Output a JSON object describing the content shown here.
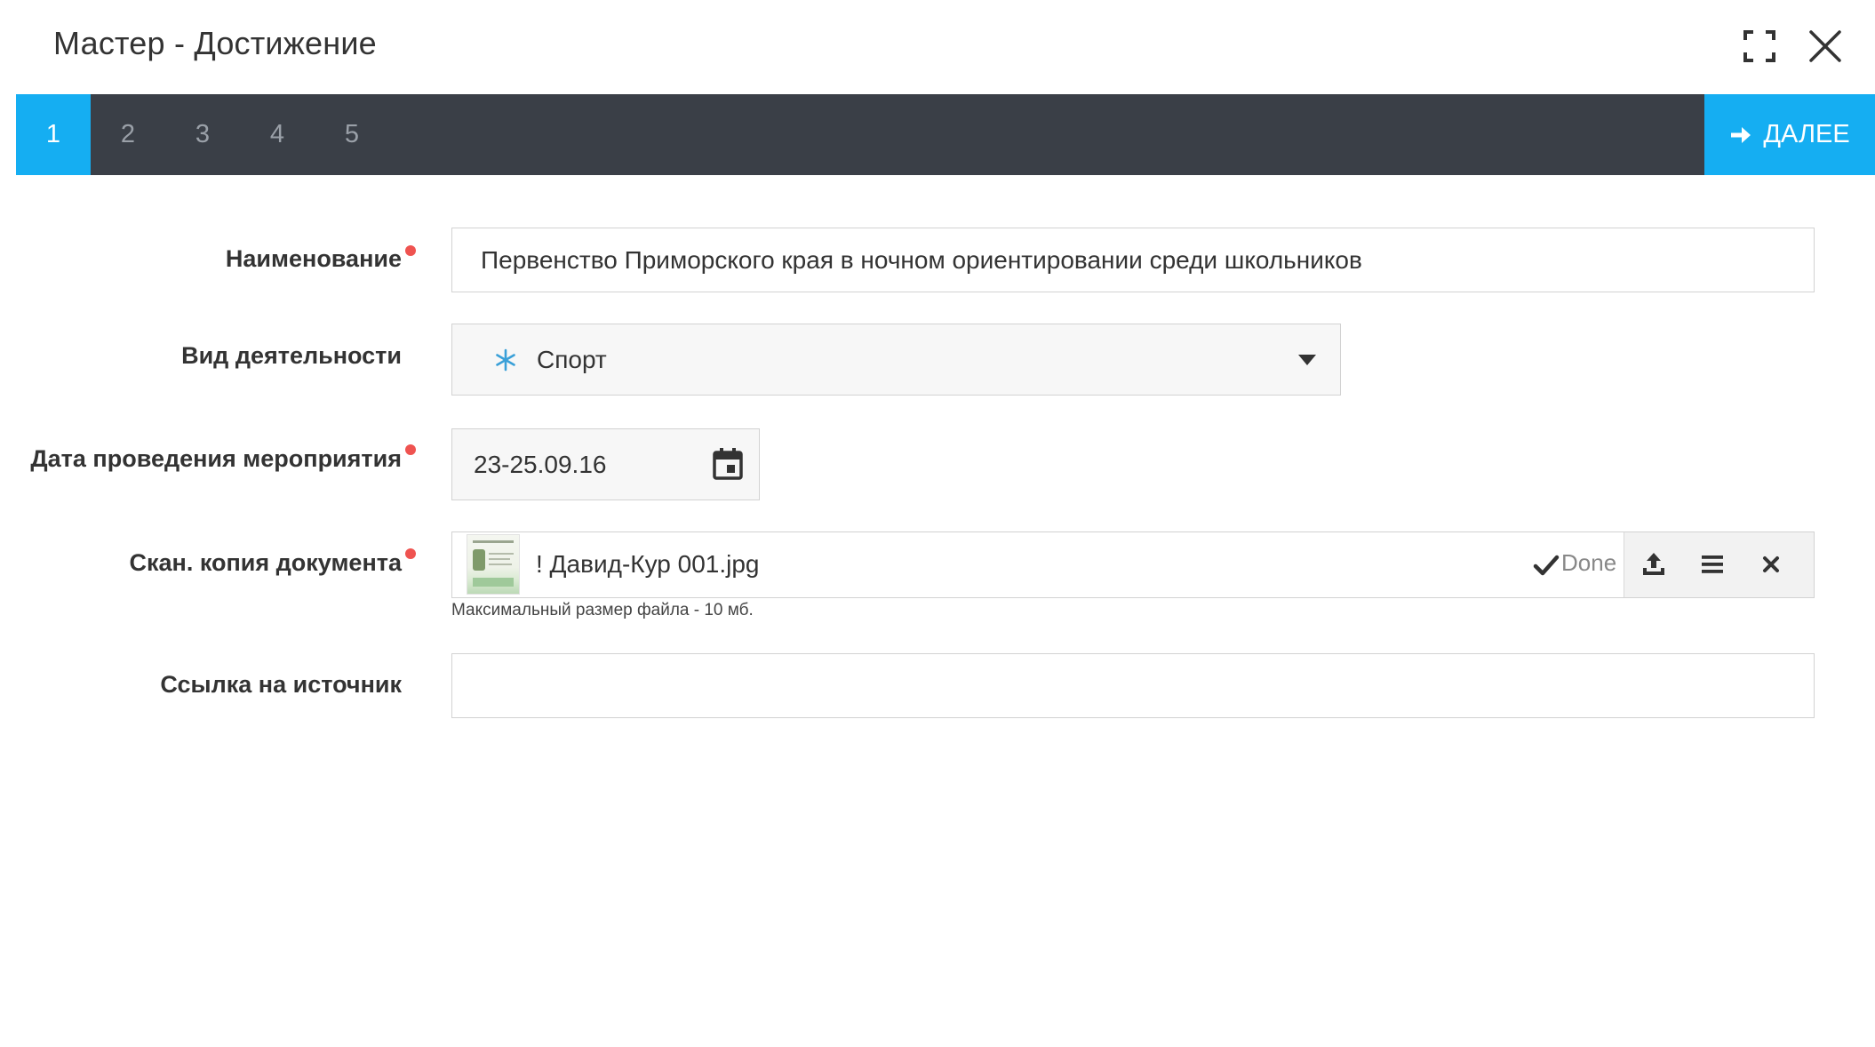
{
  "dialog": {
    "title": "Мастер - Достижение"
  },
  "steps": [
    "1",
    "2",
    "3",
    "4",
    "5"
  ],
  "active_step": "1",
  "next_label": "ДАЛЕЕ",
  "form": {
    "name_label": "Наименование",
    "name_value": "Первенство Приморского края в ночном ориентировании среди школьников",
    "activity_label": "Вид деятельности",
    "activity_value": "Спорт",
    "date_label": "Дата проведения мероприятия",
    "date_value": "23-25.09.16",
    "scan_label": "Скан. копия документа",
    "scan_filename": "! Давид-Кур 001.jpg",
    "scan_status": "Done",
    "scan_hint": "Максимальный размер файла - 10 мб.",
    "source_label": "Ссылка на источник",
    "source_value": ""
  },
  "colors": {
    "accent": "#15aef2",
    "stepbar": "#3a3f47",
    "required": "#ef5350"
  }
}
